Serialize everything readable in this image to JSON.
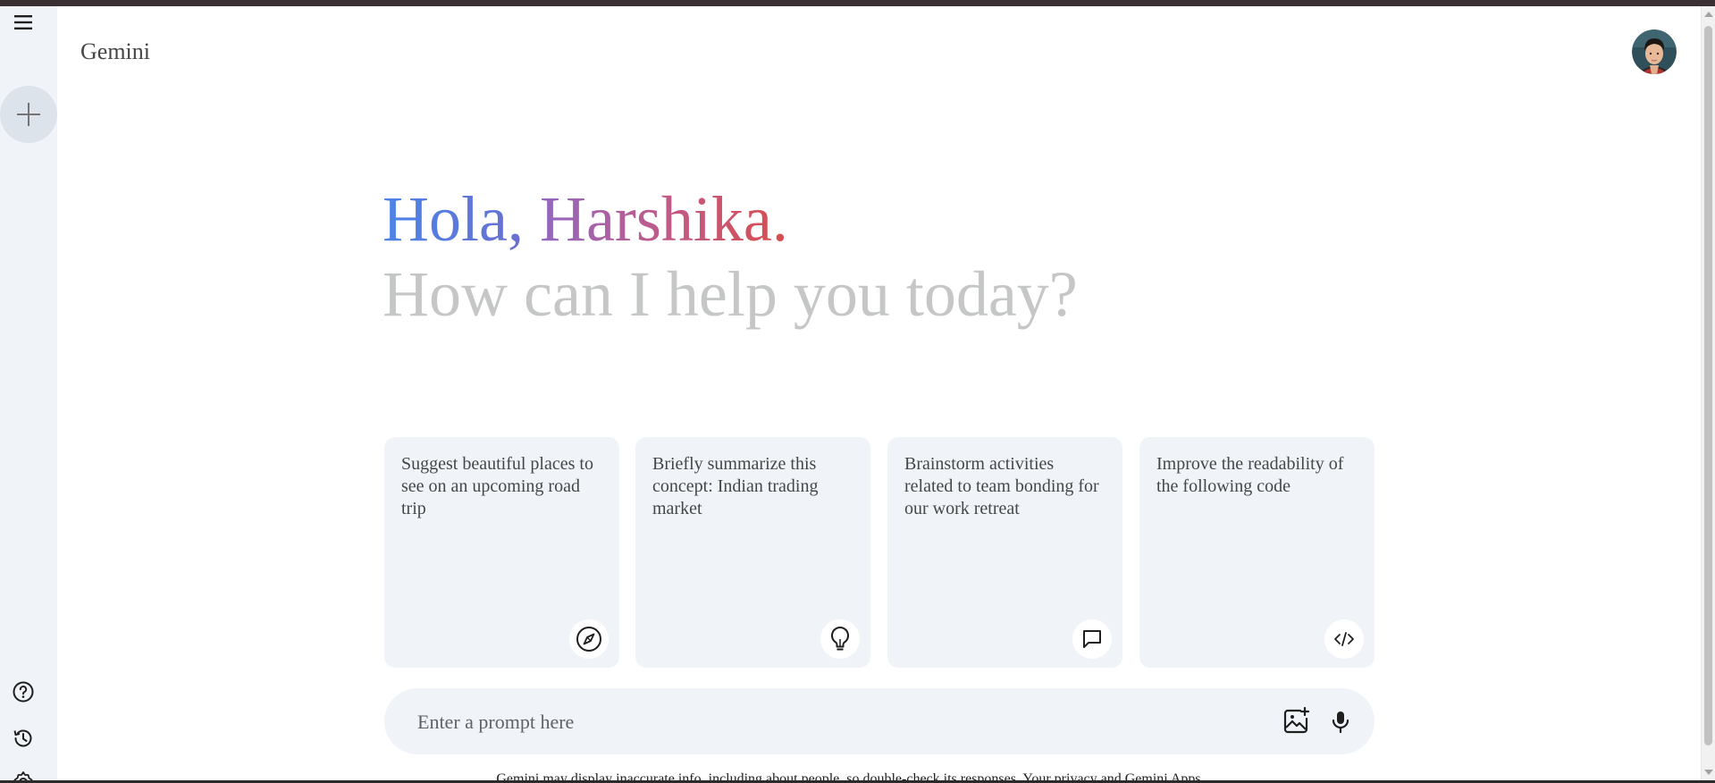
{
  "app": {
    "title": "Gemini"
  },
  "sidebar": {
    "menu_icon": "hamburger-menu-icon",
    "new_chat_icon": "plus-icon",
    "bottom_icons": [
      "help-icon",
      "history-icon",
      "settings-icon"
    ]
  },
  "greeting": {
    "hello": "Hola,",
    "name": "Harshika.",
    "subtitle": "How can I help you today?"
  },
  "cards": [
    {
      "text": "Suggest beautiful places to see on an upcoming road trip",
      "icon": "compass-icon"
    },
    {
      "text": "Briefly summarize this concept: Indian trading market",
      "icon": "lightbulb-icon"
    },
    {
      "text": "Brainstorm activities related to team bonding for our work retreat",
      "icon": "chat-bubble-icon"
    },
    {
      "text": "Improve the readability of the following code",
      "icon": "code-icon"
    }
  ],
  "prompt": {
    "placeholder": "Enter a prompt here",
    "upload_icon": "image-upload-icon",
    "mic_icon": "microphone-icon"
  },
  "disclaimer": {
    "text": "Gemini may display inaccurate info, including about people, so double-check its responses.",
    "link": "Your privacy and Gemini Apps"
  },
  "colors": {
    "sidebar_bg": "#f0f4f9",
    "card_bg": "#f0f4f9",
    "greeting_blue": "#4b84e8",
    "greeting_red": "#d94d4d",
    "subtitle_gray": "#c4c7c5"
  }
}
